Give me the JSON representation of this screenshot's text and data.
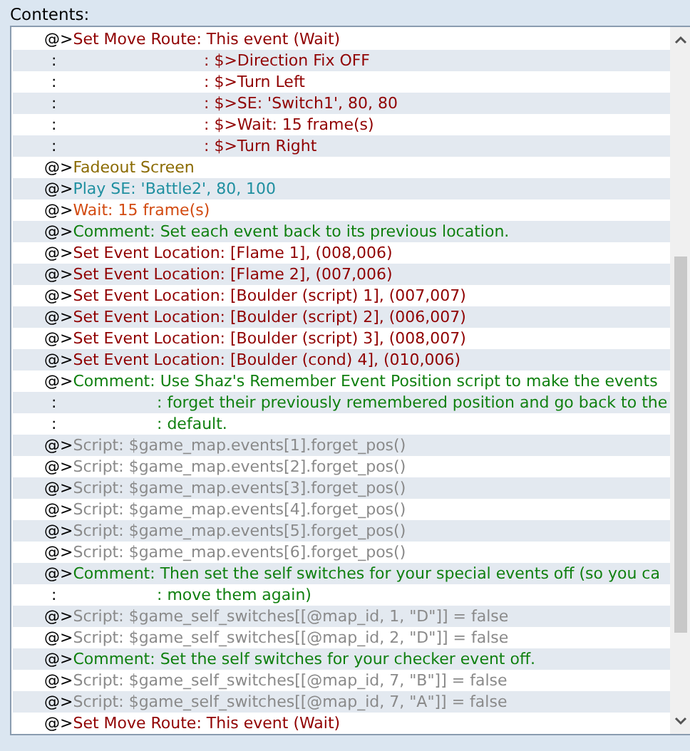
{
  "label": "Contents:",
  "rows": [
    {
      "kind": "route",
      "marker": "@>",
      "text": "Set Move Route: This event (Wait)"
    },
    {
      "kind": "route-step",
      "marker": ":",
      "text": ": $>Direction Fix OFF"
    },
    {
      "kind": "route-step",
      "marker": ":",
      "text": ": $>Turn Left"
    },
    {
      "kind": "route-step",
      "marker": ":",
      "text": ": $>SE: 'Switch1', 80, 80"
    },
    {
      "kind": "route-step",
      "marker": ":",
      "text": ": $>Wait: 15 frame(s)"
    },
    {
      "kind": "route-step",
      "marker": ":",
      "text": ": $>Turn Right"
    },
    {
      "kind": "screen",
      "marker": "@>",
      "text": "Fadeout Screen"
    },
    {
      "kind": "sound",
      "marker": "@>",
      "text": "Play SE: 'Battle2', 80, 100"
    },
    {
      "kind": "wait",
      "marker": "@>",
      "text": "Wait: 15 frame(s)"
    },
    {
      "kind": "comment",
      "marker": "@>",
      "text": "Comment: Set each event back to its previous location."
    },
    {
      "kind": "location",
      "marker": "@>",
      "text": "Set Event Location: [Flame 1], (008,006)"
    },
    {
      "kind": "location",
      "marker": "@>",
      "text": "Set Event Location: [Flame 2], (007,006)"
    },
    {
      "kind": "location",
      "marker": "@>",
      "text": "Set Event Location: [Boulder (script) 1], (007,007)"
    },
    {
      "kind": "location",
      "marker": "@>",
      "text": "Set Event Location: [Boulder (script) 2], (006,007)"
    },
    {
      "kind": "location",
      "marker": "@>",
      "text": "Set Event Location: [Boulder (script) 3], (008,007)"
    },
    {
      "kind": "location",
      "marker": "@>",
      "text": "Set Event Location: [Boulder (cond) 4], (010,006)"
    },
    {
      "kind": "comment",
      "marker": "@>",
      "text": "Comment: Use Shaz's Remember Event Position script to make the events"
    },
    {
      "kind": "comment-more",
      "marker": ":",
      "text": ": forget their previously remembered position and go back to the"
    },
    {
      "kind": "comment-more",
      "marker": ":",
      "text": ": default."
    },
    {
      "kind": "script",
      "marker": "@>",
      "text": "Script: $game_map.events[1].forget_pos()"
    },
    {
      "kind": "script",
      "marker": "@>",
      "text": "Script: $game_map.events[2].forget_pos()"
    },
    {
      "kind": "script",
      "marker": "@>",
      "text": "Script: $game_map.events[3].forget_pos()"
    },
    {
      "kind": "script",
      "marker": "@>",
      "text": "Script: $game_map.events[4].forget_pos()"
    },
    {
      "kind": "script",
      "marker": "@>",
      "text": "Script: $game_map.events[5].forget_pos()"
    },
    {
      "kind": "script",
      "marker": "@>",
      "text": "Script: $game_map.events[6].forget_pos()"
    },
    {
      "kind": "comment",
      "marker": "@>",
      "text": "Comment: Then set the self switches for your special events off (so you ca"
    },
    {
      "kind": "comment-more",
      "marker": ":",
      "text": ": move them again)"
    },
    {
      "kind": "script",
      "marker": "@>",
      "text": "Script: $game_self_switches[[@map_id, 1, \"D\"]] = false"
    },
    {
      "kind": "script",
      "marker": "@>",
      "text": "Script: $game_self_switches[[@map_id, 2, \"D\"]] = false"
    },
    {
      "kind": "comment",
      "marker": "@>",
      "text": "Comment: Set the self switches for your checker event off."
    },
    {
      "kind": "script",
      "marker": "@>",
      "text": "Script: $game_self_switches[[@map_id, 7, \"B\"]] = false"
    },
    {
      "kind": "script",
      "marker": "@>",
      "text": "Script: $game_self_switches[[@map_id, 7, \"A\"]] = false"
    },
    {
      "kind": "route",
      "marker": "@>",
      "text": "Set Move Route: This event (Wait)"
    }
  ]
}
